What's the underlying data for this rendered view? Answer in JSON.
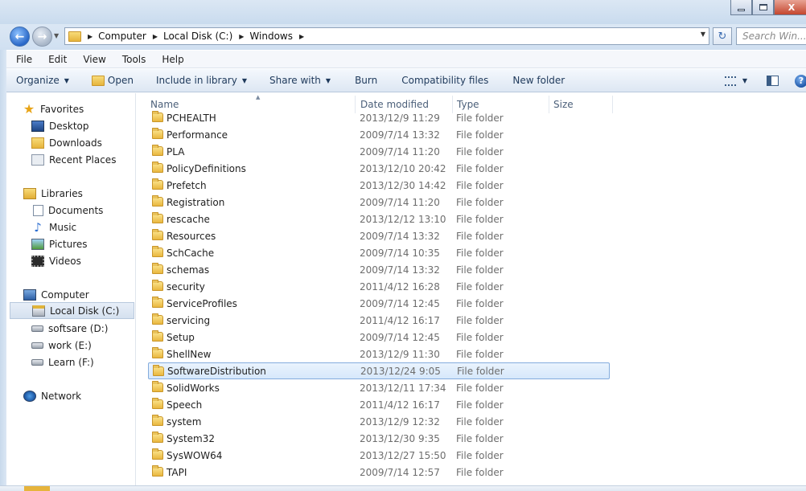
{
  "window": {
    "minimize_glyph": "",
    "close_glyph": "X"
  },
  "nav": {
    "back_glyph": "←",
    "forward_glyph": "→",
    "refresh_glyph": "↻"
  },
  "address": {
    "crumbs": [
      "Computer",
      "Local Disk (C:)",
      "Windows"
    ]
  },
  "search": {
    "placeholder": "Search Win..."
  },
  "menu": {
    "items": [
      "File",
      "Edit",
      "View",
      "Tools",
      "Help"
    ]
  },
  "toolbar": {
    "organize": "Organize",
    "open": "Open",
    "include_in_library": "Include in library",
    "share_with": "Share with",
    "burn": "Burn",
    "compatibility_files": "Compatibility files",
    "new_folder": "New folder",
    "help_glyph": "?"
  },
  "sidebar": {
    "favorites": "Favorites",
    "desktop": "Desktop",
    "downloads": "Downloads",
    "recent_places": "Recent Places",
    "libraries": "Libraries",
    "documents": "Documents",
    "music": "Music",
    "pictures": "Pictures",
    "videos": "Videos",
    "computer": "Computer",
    "local_disk_c": "Local Disk (C:)",
    "softsare_d": "softsare (D:)",
    "work_e": "work (E:)",
    "learn_f": "Learn (F:)",
    "network": "Network"
  },
  "columns": {
    "name": "Name",
    "date_modified": "Date modified",
    "type": "Type",
    "size": "Size"
  },
  "files": [
    {
      "name": "PCHEALTH",
      "date": "2013/12/9 11:29",
      "type": "File folder"
    },
    {
      "name": "Performance",
      "date": "2009/7/14 13:32",
      "type": "File folder"
    },
    {
      "name": "PLA",
      "date": "2009/7/14 11:20",
      "type": "File folder"
    },
    {
      "name": "PolicyDefinitions",
      "date": "2013/12/10 20:42",
      "type": "File folder"
    },
    {
      "name": "Prefetch",
      "date": "2013/12/30 14:42",
      "type": "File folder"
    },
    {
      "name": "Registration",
      "date": "2009/7/14 11:20",
      "type": "File folder"
    },
    {
      "name": "rescache",
      "date": "2013/12/12 13:10",
      "type": "File folder"
    },
    {
      "name": "Resources",
      "date": "2009/7/14 13:32",
      "type": "File folder"
    },
    {
      "name": "SchCache",
      "date": "2009/7/14 10:35",
      "type": "File folder"
    },
    {
      "name": "schemas",
      "date": "2009/7/14 13:32",
      "type": "File folder"
    },
    {
      "name": "security",
      "date": "2011/4/12 16:28",
      "type": "File folder"
    },
    {
      "name": "ServiceProfiles",
      "date": "2009/7/14 12:45",
      "type": "File folder"
    },
    {
      "name": "servicing",
      "date": "2011/4/12 16:17",
      "type": "File folder"
    },
    {
      "name": "Setup",
      "date": "2009/7/14 12:45",
      "type": "File folder"
    },
    {
      "name": "ShellNew",
      "date": "2013/12/9 11:30",
      "type": "File folder"
    },
    {
      "name": "SoftwareDistribution",
      "date": "2013/12/24 9:05",
      "type": "File folder"
    },
    {
      "name": "SolidWorks",
      "date": "2013/12/11 17:34",
      "type": "File folder"
    },
    {
      "name": "Speech",
      "date": "2011/4/12 16:17",
      "type": "File folder"
    },
    {
      "name": "system",
      "date": "2013/12/9 12:32",
      "type": "File folder"
    },
    {
      "name": "System32",
      "date": "2013/12/30 9:35",
      "type": "File folder"
    },
    {
      "name": "SysWOW64",
      "date": "2013/12/27 15:50",
      "type": "File folder"
    },
    {
      "name": "TAPI",
      "date": "2009/7/14 12:57",
      "type": "File folder"
    }
  ]
}
